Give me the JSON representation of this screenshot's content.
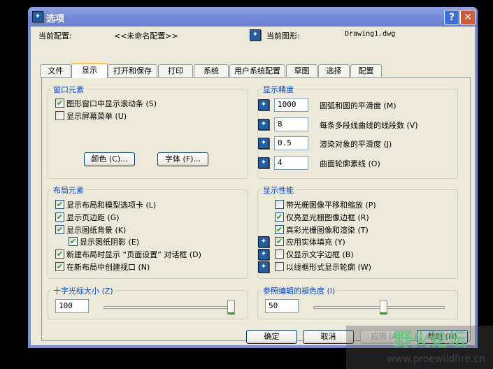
{
  "window": {
    "title": "选项",
    "help_glyph": "?",
    "close_glyph": "✕"
  },
  "header": {
    "profile_label": "当前配置:",
    "profile_value": "<<未命名配置>>",
    "drawing_label": "当前图形:",
    "drawing_value": "Drawing1.dwg"
  },
  "tabs": [
    "文件",
    "显示",
    "打开和保存",
    "打印",
    "系统",
    "用户系统配置",
    "草图",
    "选择",
    "配置"
  ],
  "active_tab": "显示",
  "window_elements": {
    "title": "窗口元素",
    "items": [
      {
        "label": "图形窗口中显示滚动条 (S)",
        "checked": true
      },
      {
        "label": "显示屏幕菜单 (U)",
        "checked": false
      }
    ],
    "colors_button": "颜色 (C)...",
    "fonts_button": "字体 (F)..."
  },
  "precision": {
    "title": "显示精度",
    "items": [
      {
        "value": "1000",
        "label": "圆弧和圆的平滑度 (M)"
      },
      {
        "value": "8",
        "label": "每条多段线曲线的线段数 (V)"
      },
      {
        "value": "0.5",
        "label": "渲染对象的平滑度 (J)"
      },
      {
        "value": "4",
        "label": "曲面轮廓素线 (O)"
      }
    ]
  },
  "layout_elements": {
    "title": "布局元素",
    "items": [
      {
        "label": "显示布局和模型选项卡 (L)",
        "checked": true
      },
      {
        "label": "显示页边距 (G)",
        "checked": true
      },
      {
        "label": "显示图纸背景 (K)",
        "checked": true
      },
      {
        "label": "显示图纸阴影 (E)",
        "checked": true
      },
      {
        "label": "新建布局时显示 “页面设置” 对话框 (D)",
        "checked": true
      },
      {
        "label": "在新布局中创建视口 (N)",
        "checked": true
      }
    ]
  },
  "performance": {
    "title": "显示性能",
    "items": [
      {
        "label": "带光栅图像平移和缩放 (P)",
        "checked": false
      },
      {
        "label": "仅亮显光栅图像边框 (R)",
        "checked": true
      },
      {
        "label": "真彩光栅图像和渲染 (T)",
        "checked": true
      },
      {
        "label": "应用实体填充 (Y)",
        "checked": true
      },
      {
        "label": "仅显示文字边框 (B)",
        "checked": false
      },
      {
        "label": "以线框形式显示轮廓 (W)",
        "checked": false
      }
    ]
  },
  "crosshair": {
    "title": "十字光标大小 (Z)",
    "value": "100",
    "slider_fraction": 1.0
  },
  "xref_fade": {
    "title": "参照编辑的褪色度 (I)",
    "value": "50",
    "slider_fraction": 0.55
  },
  "buttons": {
    "ok": "确定",
    "cancel": "取消",
    "apply": "应用 (A)",
    "help": "帮助 (H)"
  },
  "watermark": {
    "text": "野火论坛",
    "url": "www.proewildfire.cn"
  }
}
